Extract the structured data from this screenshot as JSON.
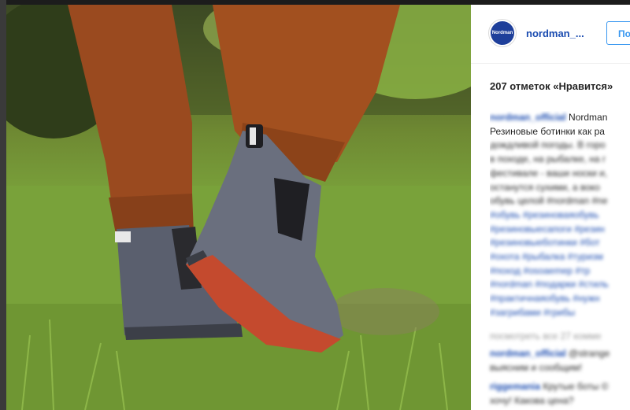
{
  "post": {
    "author": {
      "username": "nordman_...",
      "avatar_text": "Nordman",
      "follow_label": "По"
    },
    "likes_text": "207 отметок «Нравится»",
    "caption": {
      "username": "nordman_official",
      "lines": [
        "Nordman",
        "Резиновые ботинки как ра",
        "дождливой погоды. В горо",
        "в походе, на рыбалке, на г",
        "фестивале - ваши носки и,",
        "останутся сухими, а воко",
        "обувь целой #nordman #ne",
        "#обувь #резиноваяобувь",
        "#резиновыесапоги #резин",
        "#резиновыеботинки #бот",
        "#охота #рыбалка #туризм",
        "#поход #osoaemep #тр",
        "#nordman #подарки #стиль",
        "#практичнаяобувь #нужн",
        "#загрибами #грибы"
      ]
    },
    "view_all_comments": "посмотреть все 27 комме",
    "comments": [
      {
        "username": "nordman_official",
        "text_first": "@strange",
        "text_second": "выясним и сообщим!"
      },
      {
        "username": "riggemania",
        "text_first": "Крутые боты ©",
        "text_second": "хочу! Какова цена?"
      }
    ]
  },
  "colors": {
    "link": "#1a4bb0",
    "follow": "#3897f0",
    "boot_body": "#5a5f6e",
    "boot_sole": "#c44a2e",
    "pants": "#9a4a1f"
  }
}
